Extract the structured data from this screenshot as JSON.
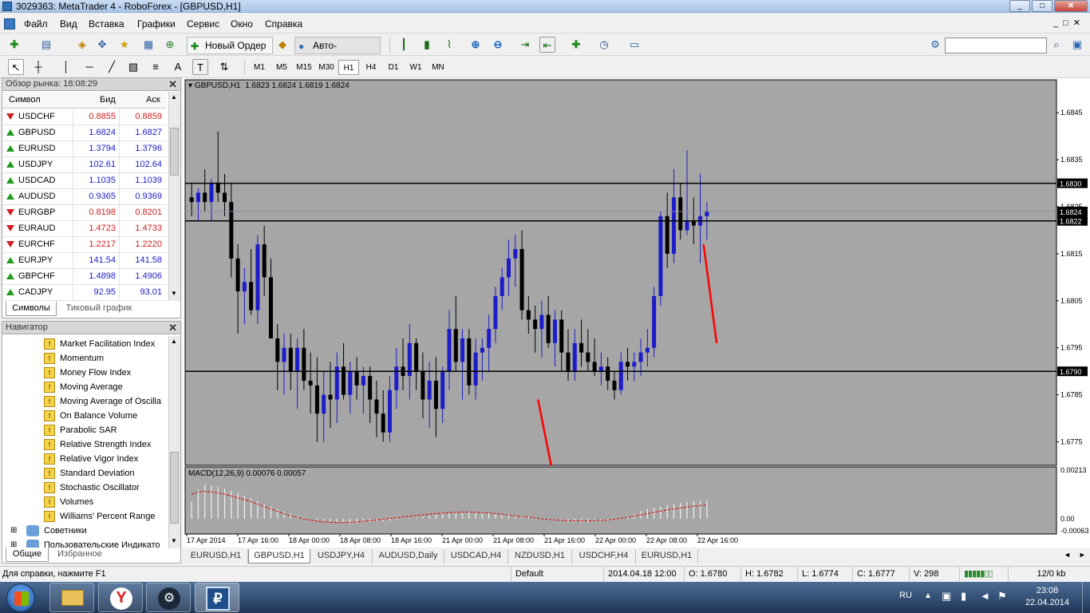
{
  "window": {
    "title": "3029363: MetaTrader 4 - RoboForex - [GBPUSD,H1]"
  },
  "menu": [
    "Файл",
    "Вид",
    "Вставка",
    "Графики",
    "Сервис",
    "Окно",
    "Справка"
  ],
  "toolbar": {
    "new_order": "Новый Ордер",
    "auto_trading": "Авто-торговля",
    "timeframes": [
      "M1",
      "M5",
      "M15",
      "M30",
      "H1",
      "H4",
      "D1",
      "W1",
      "MN"
    ],
    "active_timeframe": "H1",
    "search_placeholder": ""
  },
  "market_watch": {
    "title": "Обзор рынка: 18:08:29",
    "col_symbol": "Символ",
    "col_bid": "Бид",
    "col_ask": "Аск",
    "rows": [
      {
        "symbol": "USDCHF",
        "bid": "0.8855",
        "ask": "0.8859",
        "dir": "down"
      },
      {
        "symbol": "GBPUSD",
        "bid": "1.6824",
        "ask": "1.6827",
        "dir": "up"
      },
      {
        "symbol": "EURUSD",
        "bid": "1.3794",
        "ask": "1.3796",
        "dir": "up"
      },
      {
        "symbol": "USDJPY",
        "bid": "102.61",
        "ask": "102.64",
        "dir": "up"
      },
      {
        "symbol": "USDCAD",
        "bid": "1.1035",
        "ask": "1.1039",
        "dir": "up"
      },
      {
        "symbol": "AUDUSD",
        "bid": "0.9365",
        "ask": "0.9369",
        "dir": "up"
      },
      {
        "symbol": "EURGBP",
        "bid": "0.8198",
        "ask": "0.8201",
        "dir": "down"
      },
      {
        "symbol": "EURAUD",
        "bid": "1.4723",
        "ask": "1.4733",
        "dir": "down"
      },
      {
        "symbol": "EURCHF",
        "bid": "1.2217",
        "ask": "1.2220",
        "dir": "down"
      },
      {
        "symbol": "EURJPY",
        "bid": "141.54",
        "ask": "141.58",
        "dir": "up"
      },
      {
        "symbol": "GBPCHF",
        "bid": "1.4898",
        "ask": "1.4906",
        "dir": "up"
      },
      {
        "symbol": "CADJPY",
        "bid": "92.95",
        "ask": "93.01",
        "dir": "up"
      }
    ],
    "tabs": [
      "Символы",
      "Тиковый график"
    ]
  },
  "navigator": {
    "title": "Навигатор",
    "items": [
      "Market Facilitation Index",
      "Momentum",
      "Money Flow Index",
      "Moving Average",
      "Moving Average of Oscilla",
      "On Balance Volume",
      "Parabolic SAR",
      "Relative Strength Index",
      "Relative Vigor Index",
      "Standard Deviation",
      "Stochastic Oscillator",
      "Volumes",
      "Williams' Percent Range"
    ],
    "folders": [
      "Советники",
      "Пользовательские Индикато"
    ],
    "tabs": [
      "Общие",
      "Избранное"
    ]
  },
  "chart": {
    "header": "GBPUSD,H1  1.6823 1.6824 1.6819 1.6824",
    "price_labels": [
      "1.6845",
      "1.6835",
      "1.6825",
      "1.6815",
      "1.6805",
      "1.6795",
      "1.6785",
      "1.6775"
    ],
    "hlines": [
      {
        "price": 1.683,
        "label": "1.6830"
      },
      {
        "price": 1.6822,
        "label": "1.6822"
      },
      {
        "price": 1.679,
        "label": "1.6790"
      }
    ],
    "current_price": {
      "price": 1.6824,
      "label": "1.6824"
    },
    "time_labels": [
      "17 Apr 2014",
      "17 Apr 16:00",
      "18 Apr 00:00",
      "18 Apr 08:00",
      "18 Apr 16:00",
      "21 Apr 00:00",
      "21 Apr 08:00",
      "21 Apr 16:00",
      "22 Apr 00:00",
      "22 Apr 08:00",
      "22 Apr 16:00"
    ],
    "macd_header": "MACD(12,26,9) 0.00076 0.00057",
    "macd_labels": [
      "0.00213",
      "0.00",
      "-0.00063"
    ],
    "colors": {
      "background": "#a6a6a6",
      "bull": "#1c1cc8",
      "bear": "#000000",
      "signal": "#e00000",
      "trend": "#ff0000",
      "histogram": "#ffffff"
    }
  },
  "chart_data": {
    "type": "candlestick",
    "symbol": "GBPUSD,H1",
    "ylim": [
      1.677,
      1.6852
    ],
    "candles": [
      [
        1.6827,
        1.683,
        1.6823,
        1.6826
      ],
      [
        1.6826,
        1.6829,
        1.6822,
        1.6828
      ],
      [
        1.6828,
        1.6833,
        1.6824,
        1.6826
      ],
      [
        1.6826,
        1.6831,
        1.6822,
        1.683
      ],
      [
        1.683,
        1.6841,
        1.6826,
        1.6828
      ],
      [
        1.6828,
        1.6832,
        1.6823,
        1.6826
      ],
      [
        1.6826,
        1.683,
        1.681,
        1.6814
      ],
      [
        1.6814,
        1.6817,
        1.6798,
        1.6807
      ],
      [
        1.6807,
        1.6812,
        1.68,
        1.6809
      ],
      [
        1.6809,
        1.6816,
        1.6802,
        1.6803
      ],
      [
        1.6803,
        1.6819,
        1.68,
        1.6817
      ],
      [
        1.6817,
        1.6821,
        1.6806,
        1.681
      ],
      [
        1.681,
        1.6814,
        1.6797,
        1.6797
      ],
      [
        1.6797,
        1.68,
        1.6786,
        1.6792
      ],
      [
        1.6792,
        1.6798,
        1.6785,
        1.6795
      ],
      [
        1.6795,
        1.6798,
        1.6786,
        1.679
      ],
      [
        1.679,
        1.6797,
        1.6782,
        1.6795
      ],
      [
        1.6795,
        1.6799,
        1.6786,
        1.6788
      ],
      [
        1.6788,
        1.6794,
        1.6781,
        1.6787
      ],
      [
        1.6787,
        1.6793,
        1.6775,
        1.6781
      ],
      [
        1.6781,
        1.679,
        1.6775,
        1.6785
      ],
      [
        1.6785,
        1.6792,
        1.6778,
        1.6784
      ],
      [
        1.6784,
        1.6794,
        1.6779,
        1.6791
      ],
      [
        1.6791,
        1.6796,
        1.6784,
        1.6785
      ],
      [
        1.6785,
        1.6792,
        1.6781,
        1.679
      ],
      [
        1.679,
        1.6793,
        1.6784,
        1.6787
      ],
      [
        1.6787,
        1.6791,
        1.6781,
        1.6789
      ],
      [
        1.6789,
        1.6791,
        1.6779,
        1.6784
      ],
      [
        1.6784,
        1.6788,
        1.6776,
        1.6781
      ],
      [
        1.6781,
        1.6786,
        1.6775,
        1.6777
      ],
      [
        1.6777,
        1.6789,
        1.6775,
        1.6786
      ],
      [
        1.6786,
        1.6795,
        1.6782,
        1.6791
      ],
      [
        1.6791,
        1.6797,
        1.6786,
        1.6789
      ],
      [
        1.6789,
        1.68,
        1.6784,
        1.6796
      ],
      [
        1.6796,
        1.6797,
        1.6786,
        1.679
      ],
      [
        1.679,
        1.6794,
        1.678,
        1.6784
      ],
      [
        1.6784,
        1.6792,
        1.6778,
        1.6788
      ],
      [
        1.6788,
        1.6793,
        1.6776,
        1.6782
      ],
      [
        1.6782,
        1.6791,
        1.6779,
        1.679
      ],
      [
        1.679,
        1.6803,
        1.6786,
        1.6799
      ],
      [
        1.6799,
        1.6806,
        1.679,
        1.6792
      ],
      [
        1.6792,
        1.6799,
        1.6784,
        1.6797
      ],
      [
        1.6797,
        1.6799,
        1.6785,
        1.6787
      ],
      [
        1.6787,
        1.6797,
        1.6784,
        1.6794
      ],
      [
        1.6794,
        1.6797,
        1.6788,
        1.6795
      ],
      [
        1.6795,
        1.6802,
        1.679,
        1.6799
      ],
      [
        1.6799,
        1.6808,
        1.6796,
        1.6806
      ],
      [
        1.6806,
        1.6812,
        1.6803,
        1.681
      ],
      [
        1.681,
        1.6818,
        1.6806,
        1.6814
      ],
      [
        1.6814,
        1.6819,
        1.6808,
        1.6816
      ],
      [
        1.6816,
        1.682,
        1.6801,
        1.6803
      ],
      [
        1.6803,
        1.6806,
        1.6798,
        1.6801
      ],
      [
        1.6801,
        1.6804,
        1.6794,
        1.6799
      ],
      [
        1.6799,
        1.6805,
        1.6793,
        1.6802
      ],
      [
        1.6802,
        1.6806,
        1.6795,
        1.6796
      ],
      [
        1.6796,
        1.6803,
        1.6791,
        1.6801
      ],
      [
        1.6801,
        1.6803,
        1.679,
        1.6794
      ],
      [
        1.6794,
        1.6799,
        1.6788,
        1.679
      ],
      [
        1.679,
        1.6799,
        1.6788,
        1.6796
      ],
      [
        1.6796,
        1.6801,
        1.6791,
        1.6794
      ],
      [
        1.6794,
        1.6799,
        1.679,
        1.6792
      ],
      [
        1.6792,
        1.6797,
        1.6789,
        1.679
      ],
      [
        1.679,
        1.6794,
        1.6787,
        1.6791
      ],
      [
        1.6791,
        1.6793,
        1.6786,
        1.6788
      ],
      [
        1.6788,
        1.679,
        1.6784,
        1.6786
      ],
      [
        1.6786,
        1.6794,
        1.6785,
        1.6792
      ],
      [
        1.6792,
        1.6795,
        1.6788,
        1.6791
      ],
      [
        1.6791,
        1.6794,
        1.6788,
        1.6792
      ],
      [
        1.6792,
        1.6797,
        1.6789,
        1.6794
      ],
      [
        1.6794,
        1.6799,
        1.6791,
        1.6795
      ],
      [
        1.6795,
        1.6808,
        1.6793,
        1.6806
      ],
      [
        1.6806,
        1.6824,
        1.6804,
        1.6823
      ],
      [
        1.6823,
        1.6828,
        1.6812,
        1.6815
      ],
      [
        1.6815,
        1.6833,
        1.6813,
        1.6827
      ],
      [
        1.6827,
        1.683,
        1.6818,
        1.682
      ],
      [
        1.682,
        1.6837,
        1.6819,
        1.6822
      ],
      [
        1.6822,
        1.6827,
        1.6817,
        1.6821
      ],
      [
        1.6821,
        1.6832,
        1.6813,
        1.6823
      ],
      [
        1.6823,
        1.6826,
        1.6818,
        1.6824
      ]
    ],
    "trend_lines": [
      {
        "x1": 0.405,
        "y1": 1.6784,
        "x2": 0.42,
        "y2": 1.677
      },
      {
        "x1": 0.595,
        "y1": 1.6817,
        "x2": 0.61,
        "y2": 1.6796
      }
    ],
    "macd": {
      "value": 0.00076,
      "signal_value": 0.00057,
      "histogram": [
        0.0007,
        0.0012,
        0.0014,
        0.00135,
        0.0013,
        0.00125,
        0.00115,
        0.00105,
        0.00095,
        0.00085,
        0.00075,
        0.0006,
        0.0005,
        0.0004,
        0.0003,
        0.0002,
        0.0001,
        5e-05,
        0.0,
        -5e-05,
        -8e-05,
        -0.0001,
        -0.00012,
        -0.00015,
        -0.00018,
        -0.00018,
        -0.00016,
        -0.00014,
        -0.00012,
        -0.0001,
        -8e-05,
        -5e-05,
        0.0,
        3e-05,
        5e-05,
        8e-05,
        0.00012,
        0.00016,
        0.0002,
        0.00022,
        0.00024,
        0.00025,
        0.00026,
        0.00025,
        0.00024,
        0.00022,
        0.0002,
        0.00018,
        0.00016,
        0.00014,
        0.00012,
        0.0001,
        5e-05,
        0.0,
        -3e-05,
        -6e-05,
        -0.0001,
        -0.00012,
        -0.00014,
        -0.00015,
        -0.00014,
        -0.00012,
        -0.0001,
        -8e-05,
        -4e-05,
        0.0,
        8e-05,
        0.0002,
        0.00032,
        0.0004,
        0.00045,
        0.0005,
        0.00055,
        0.0006,
        0.00065,
        0.0007,
        0.00072,
        0.00074,
        0.00076
      ],
      "signal": [
        0.001,
        0.0011,
        0.00112,
        0.0011,
        0.00106,
        0.001,
        0.00094,
        0.00086,
        0.00078,
        0.0007,
        0.0006,
        0.0005,
        0.0004,
        0.0003,
        0.0002,
        0.00012,
        5e-05,
        -1e-05,
        -6e-05,
        -0.0001,
        -0.00013,
        -0.00015,
        -0.00016,
        -0.00016,
        -0.00015,
        -0.00013,
        -0.00011,
        -8e-05,
        -5e-05,
        -2e-05,
        1e-05,
        4e-05,
        7e-05,
        0.0001,
        0.00013,
        0.00016,
        0.00019,
        0.00021,
        0.00023,
        0.00025,
        0.00026,
        0.00027,
        0.00027,
        0.00026,
        0.00025,
        0.00023,
        0.00021,
        0.00018,
        0.00015,
        0.00012,
        9e-05,
        6e-05,
        3e-05,
        0.0,
        -3e-05,
        -5e-05,
        -7e-05,
        -8e-05,
        -9e-05,
        -9e-05,
        -9e-05,
        -8e-05,
        -7e-05,
        -5e-05,
        -2e-05,
        2e-05,
        6e-05,
        0.00011,
        0.00016,
        0.00021,
        0.00026,
        0.00031,
        0.00036,
        0.0004,
        0.00044,
        0.00048,
        0.00051,
        0.00054,
        0.00057
      ]
    }
  },
  "chart_tabs": [
    "EURUSD,H1",
    "GBPUSD,H1",
    "USDJPY,H4",
    "AUDUSD,Daily",
    "USDCAD,H4",
    "NZDUSD,H1",
    "USDCHF,H4",
    "EURUSD,H1"
  ],
  "active_chart_tab": "GBPUSD,H1",
  "status": {
    "help": "Для справки, нажмите F1",
    "profile": "Default",
    "datetime": "2014.04.18 12:00",
    "open": "O: 1.6780",
    "high": "H: 1.6782",
    "low": "L: 1.6774",
    "close": "C: 1.6777",
    "volume": "V: 298",
    "traffic": "12/0 kb"
  },
  "taskbar": {
    "lang": "RU",
    "time": "23:08",
    "date": "22.04.2014"
  }
}
